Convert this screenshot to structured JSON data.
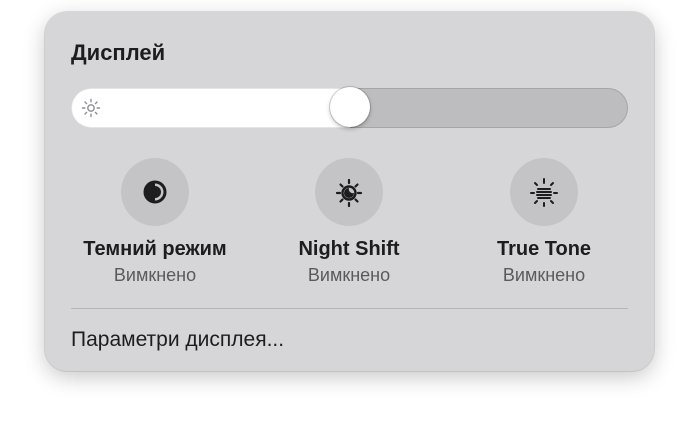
{
  "display": {
    "title": "Дисплей",
    "brightness": 0.5,
    "brightness_icon": "sun-icon",
    "toggles": [
      {
        "name": "Темний режим",
        "status": "Вимкнено",
        "icon": "dark-mode-icon"
      },
      {
        "name": "Night Shift",
        "status": "Вимкнено",
        "icon": "night-shift-icon"
      },
      {
        "name": "True Tone",
        "status": "Вимкнено",
        "icon": "true-tone-icon"
      }
    ],
    "settings_link": "Параметри дисплея..."
  },
  "colors": {
    "panel": "#d6d6d8",
    "toggle_off": "#c4c4c6",
    "slider_fill": "#ffffff",
    "slider_track": "#bdbdbf"
  }
}
